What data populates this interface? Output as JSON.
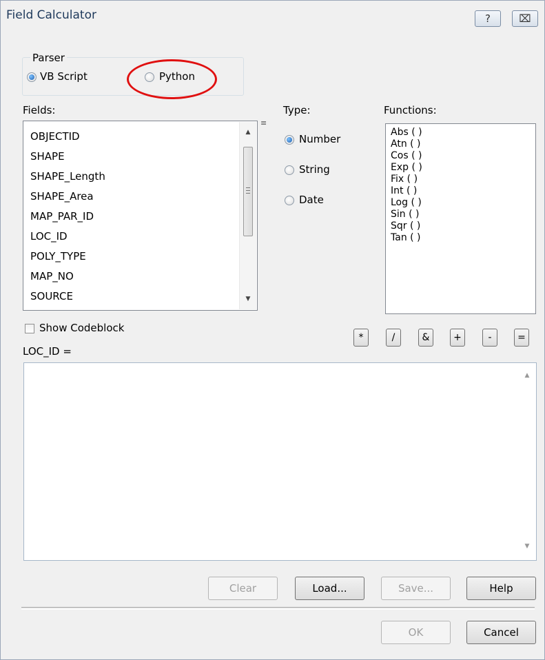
{
  "window": {
    "title": "Field Calculator",
    "help_glyph": "?",
    "close_glyph": "⌧"
  },
  "parser": {
    "label": "Parser",
    "options": [
      "VB Script",
      "Python"
    ],
    "selected": "VB Script",
    "annotation_color": "#e01010"
  },
  "fields": {
    "label": "Fields:",
    "items": [
      "OBJECTID",
      "SHAPE",
      "SHAPE_Length",
      "SHAPE_Area",
      "MAP_PAR_ID",
      "LOC_ID",
      "POLY_TYPE",
      "MAP_NO",
      "SOURCE"
    ]
  },
  "type": {
    "label": "Type:",
    "options": [
      "Number",
      "String",
      "Date"
    ],
    "selected": "Number"
  },
  "functions": {
    "label": "Functions:",
    "items": [
      "Abs ( )",
      "Atn ( )",
      "Cos ( )",
      "Exp ( )",
      "Fix ( )",
      "Int ( )",
      "Log ( )",
      "Sin ( )",
      "Sqr ( )",
      "Tan ( )"
    ]
  },
  "codeblock": {
    "label": "Show Codeblock",
    "checked": false
  },
  "operators": [
    "*",
    "/",
    "&",
    "+",
    "-",
    "="
  ],
  "expression": {
    "label": "LOC_ID =",
    "value": ""
  },
  "buttons": {
    "clear": "Clear",
    "load": "Load...",
    "save": "Save...",
    "help": "Help",
    "ok": "OK",
    "cancel": "Cancel"
  }
}
